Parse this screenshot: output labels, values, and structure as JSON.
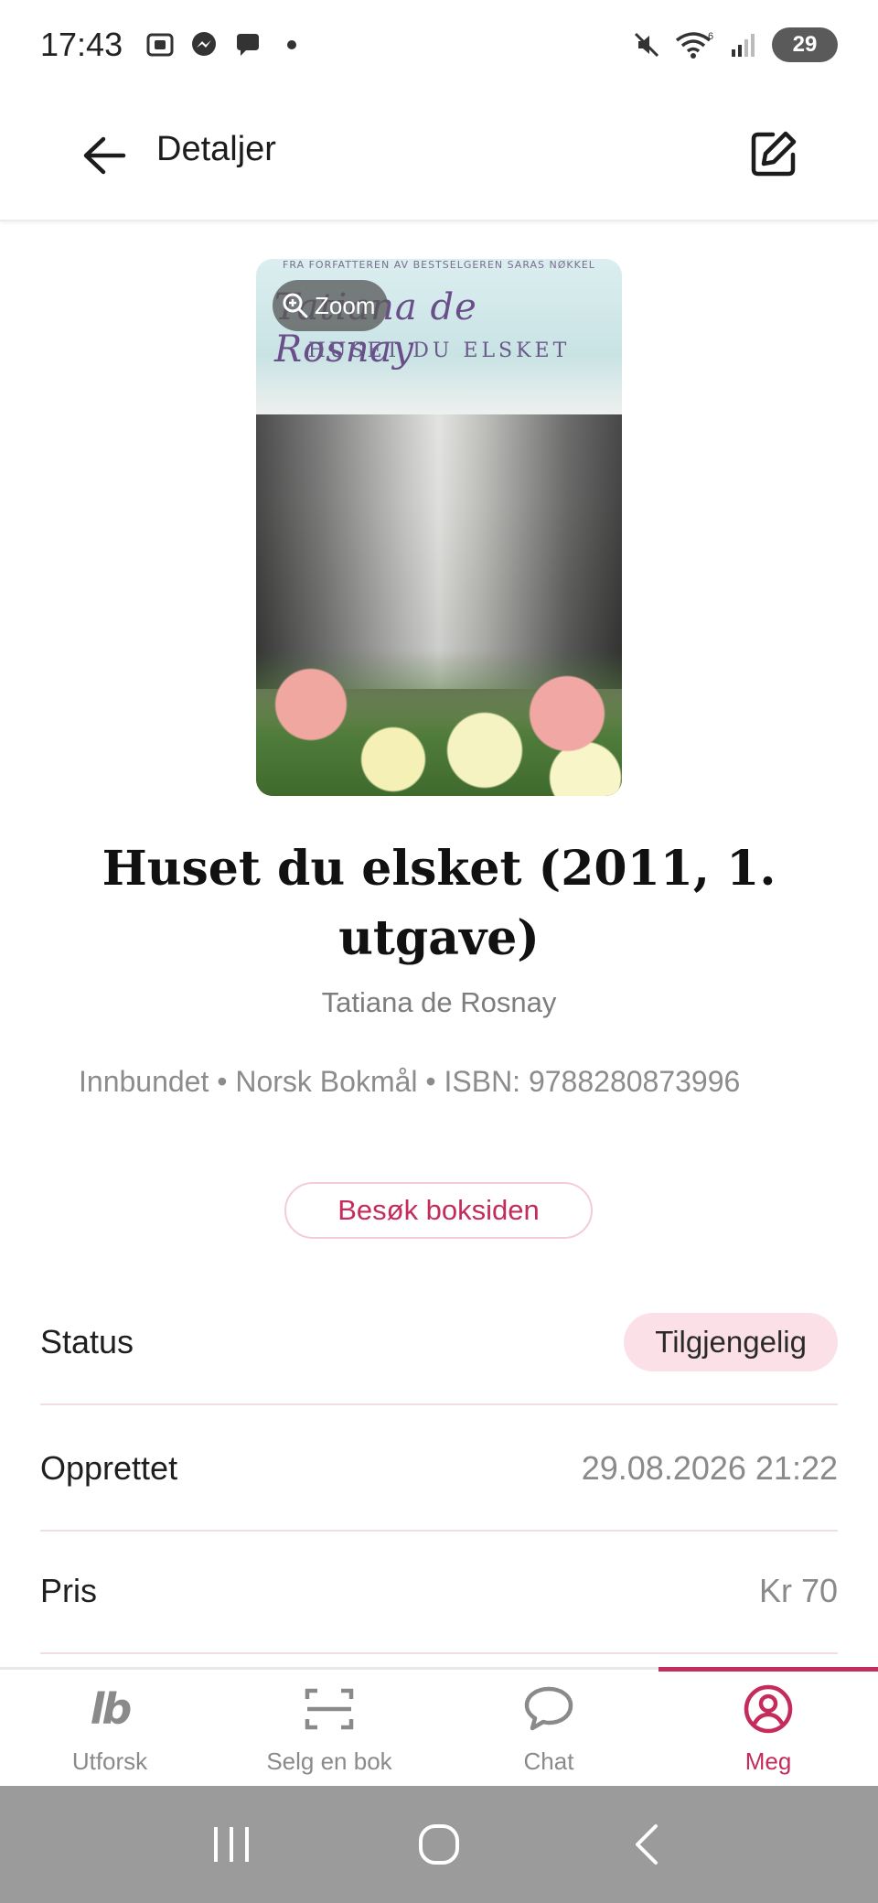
{
  "status_bar": {
    "time": "17:43",
    "left_icons": [
      "screenshot-icon",
      "messenger-icon",
      "chat-bubble-icon",
      "dot-icon"
    ],
    "right_icons": [
      "mute-icon",
      "wifi-icon",
      "signal-icon"
    ],
    "wifi_badge": "6",
    "battery": "29"
  },
  "app_bar": {
    "title": "Detaljer",
    "back_icon": "arrow-left-icon",
    "edit_icon": "edit-icon"
  },
  "cover": {
    "top_line": "FRA FORFATTEREN AV BESTSELGEREN SARAS NØKKEL",
    "author_script": "Tatiana de Rosnay",
    "title": "HUSET DU ELSKET",
    "zoom_label": "Zoom"
  },
  "book": {
    "title": "Huset du elsket (2011, 1. utgave)",
    "author": "Tatiana de Rosnay",
    "meta": "Innbundet • Norsk Bokmål • ISBN: 9788280873996",
    "visit_label": "Besøk boksiden"
  },
  "details": [
    {
      "label": "Status",
      "value": "Tilgjengelig"
    },
    {
      "label": "Opprettet",
      "value": "29.08.2026 21:22"
    },
    {
      "label": "Pris",
      "value": "Kr 70"
    }
  ],
  "bottom_nav": {
    "items": [
      {
        "label": "Utforsk",
        "icon": "lb-logo-icon",
        "active": false
      },
      {
        "label": "Selg en bok",
        "icon": "scan-icon",
        "active": false
      },
      {
        "label": "Chat",
        "icon": "chat-icon",
        "active": false
      },
      {
        "label": "Meg",
        "icon": "profile-icon",
        "active": true
      }
    ],
    "logo_text": "lb"
  },
  "colors": {
    "accent": "#c42c5b",
    "pill_bg": "#fbe1e7",
    "muted_text": "#8a8a8a"
  }
}
